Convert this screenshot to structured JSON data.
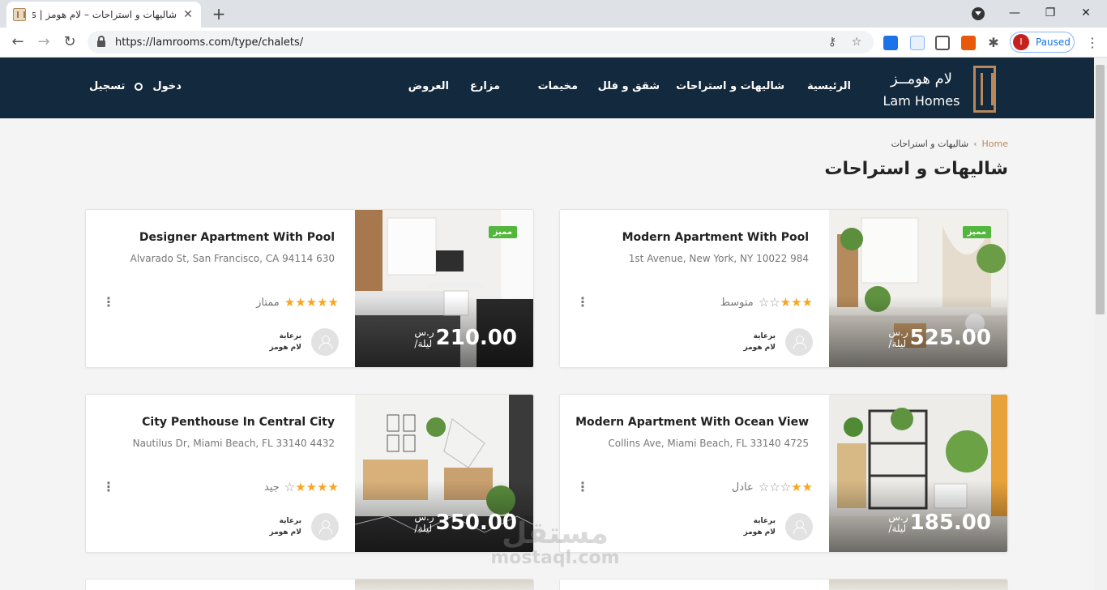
{
  "browser": {
    "tab_title": "شاليهات و استراحات – لام هومز | Chalets",
    "tab_close": "✕",
    "new_tab": "+",
    "url": "https://lamrooms.com/type/chalets/",
    "profile_initial": "I",
    "profile_status": "Paused",
    "icons": [
      "back-icon",
      "forward-icon",
      "reload-icon",
      "lock-icon",
      "key-icon",
      "star-icon",
      "puzzle-icon"
    ]
  },
  "site": {
    "logo_ar": "لام هومــز",
    "logo_en": "Lam Homes",
    "nav": [
      "الرئيسية",
      "شاليهات و استراحات",
      "شقق و فلل",
      "مخيمات",
      "مزارع",
      "العروض"
    ],
    "login": "دخول",
    "register": "تسجيل",
    "accent_color": "#b8875a",
    "header_color": "#13293d",
    "badge_color": "#53b73d"
  },
  "breadcrumb": {
    "home": "Home",
    "separator": "›",
    "current": "شاليهات و استراحات"
  },
  "page_title": "شاليهات و استراحات",
  "listings": [
    {
      "title": "Modern Apartment With Pool",
      "address": "1st Avenue, New York, NY 10022 984",
      "badge": "مميز",
      "price": "525.00",
      "currency": "ر.س",
      "per": "/ليلة",
      "rating": 3,
      "rating_label": "متوسط",
      "owner_line1": "برعاية",
      "owner_line2": "لام هومز"
    },
    {
      "title": "Designer Apartment With Pool",
      "address": "Alvarado St, San Francisco, CA 94114 630",
      "badge": "مميز",
      "price": "210.00",
      "currency": "ر.س",
      "per": "/ليلة",
      "rating": 5,
      "rating_label": "ممتاز",
      "owner_line1": "برعاية",
      "owner_line2": "لام هومز"
    },
    {
      "title": "Modern Apartment With Ocean View",
      "address": "Collins Ave, Miami Beach, FL 33140 4725",
      "badge": "",
      "price": "185.00",
      "currency": "ر.س",
      "per": "/ليلة",
      "rating": 2,
      "rating_label": "عادل",
      "owner_line1": "برعاية",
      "owner_line2": "لام هومز"
    },
    {
      "title": "City Penthouse In Central City",
      "address": "Nautilus Dr, Miami Beach, FL 33140 4432",
      "badge": "",
      "price": "350.00",
      "currency": "ر.س",
      "per": "/ليلة",
      "rating": 4,
      "rating_label": "جيد",
      "owner_line1": "برعاية",
      "owner_line2": "لام هومز"
    }
  ],
  "watermark": {
    "ar": "مستقل",
    "en": "mostaql.com"
  }
}
